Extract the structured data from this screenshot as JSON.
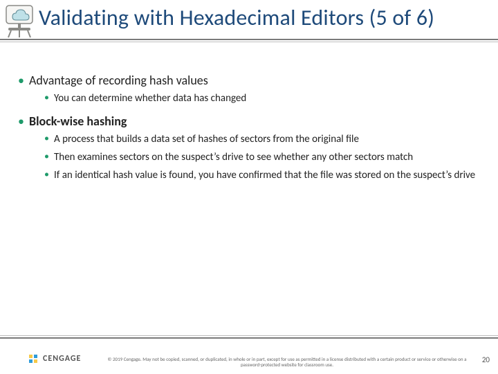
{
  "header": {
    "title": "Validating with Hexadecimal Editors (5 of 6)",
    "icon": "cloud-projector-icon"
  },
  "body": {
    "bullets": [
      {
        "text": "Advantage of recording hash values",
        "bold": false,
        "sub": [
          "You can determine whether data has changed"
        ]
      },
      {
        "text": "Block-wise hashing",
        "bold": true,
        "sub": [
          "A process that builds a data set of hashes of sectors from the original file",
          "Then examines sectors on the suspect’s drive to see whether any other sectors match",
          "If an identical hash value is found, you have confirmed that the file was stored on the suspect’s drive"
        ]
      }
    ]
  },
  "footer": {
    "brand": "CENGAGE",
    "copyright": "© 2019 Cengage. May not be copied, scanned, or duplicated, in whole or in part, except for use as permitted in a license distributed with a certain product or service or otherwise on a password-protected website for classroom use.",
    "page": "20"
  }
}
